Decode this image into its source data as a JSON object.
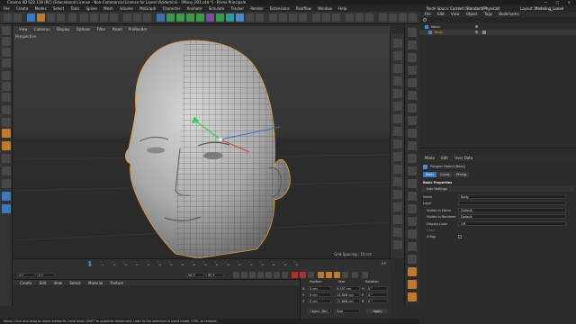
{
  "window": {
    "title": "Cinema 4D S22.118 (RC) (Educational License - Non-Commercial License for Lionel Vicidomini) - [Mono_003.c4d *] - Prima Principale",
    "controls": [
      "—",
      "□",
      "×"
    ]
  },
  "menubar": {
    "items": [
      "File",
      "Create",
      "Modes",
      "Select",
      "Tools",
      "Spline",
      "Mesh",
      "Volume",
      "MoGraph",
      "Character",
      "Animate",
      "Simulate",
      "Tracker",
      "Render",
      "Extensions",
      "Realflow",
      "Window",
      "Help"
    ],
    "node_space_label": "Node Space:",
    "node_space_value": "Current (Standard/Physical)",
    "layout_label": "Layout:",
    "layout_value": "Modeling_Lionel (User)"
  },
  "viewport": {
    "menu": [
      "View",
      "Cameras",
      "Display",
      "Options",
      "Filter",
      "Panel",
      "ProRender"
    ],
    "label": "Perspective",
    "grid_spacing": "Grid Spacing : 10 cm"
  },
  "timeline": {
    "ticks": [
      "0",
      "5",
      "10",
      "15",
      "20",
      "25",
      "30",
      "35",
      "40",
      "45",
      "50",
      "55",
      "60",
      "65",
      "70",
      "75",
      "80",
      "85",
      "90"
    ],
    "end_frame": "0 F",
    "start_field": "0 F",
    "current_field": "0 F",
    "max_field": "90 F",
    "end_field": "90 F"
  },
  "material_manager": {
    "menu": [
      "Create",
      "Edit",
      "View",
      "Select",
      "Material",
      "Texture"
    ]
  },
  "coordinates": {
    "headers": [
      "Position",
      "Size",
      "Rotation"
    ],
    "rows": [
      {
        "axis": "X",
        "pos": "0 cm",
        "size": "9.357 cm",
        "rot_axis": "H",
        "rot": "0 °"
      },
      {
        "axis": "Y",
        "pos": "0 cm",
        "size": "14.608 cm",
        "rot_axis": "P",
        "rot": "0 °"
      },
      {
        "axis": "Z",
        "pos": "0 cm",
        "size": "17.608 cm",
        "rot_axis": "B",
        "rot": "0 °"
      }
    ],
    "mode": "Object (Rel)",
    "size_mode": "Size",
    "apply_label": "Apply"
  },
  "status": {
    "text": "Move: Click and drag to move elements. Hold down SHIFT to quantize movement / add to the selection in point mode, CTRL to remove."
  },
  "object_manager": {
    "menu": [
      "File",
      "Edit",
      "View",
      "Object",
      "Tags",
      "Bookmarks"
    ],
    "objects": [
      {
        "name": "Mono",
        "type": "polygon",
        "selected": false
      },
      {
        "name": "Body",
        "type": "polygon",
        "selected": true
      }
    ]
  },
  "attribute_manager": {
    "menu": [
      "Mode",
      "Edit",
      "User Data"
    ],
    "title": "Polygon Object [Body]",
    "tabs": [
      "Basic",
      "Coord.",
      "Phong"
    ],
    "active_tab": "Basic",
    "section_title": "Basic Properties",
    "subsection": "Icon Settings",
    "fields": [
      {
        "label": "Name",
        "value": "Body"
      },
      {
        "label": "Layer",
        "value": ""
      },
      {
        "label": "Visible in Editor",
        "value": "Default"
      },
      {
        "label": "Visible in Renderer",
        "value": "Default"
      },
      {
        "label": "Display Color",
        "value": "Off"
      },
      {
        "label": "Color",
        "value": ""
      },
      {
        "label": "X-Ray",
        "value": ""
      }
    ]
  },
  "colors": {
    "accent_orange": "#f0a030",
    "selection_orange": "#ff9a1e",
    "active_blue": "#3a78c0",
    "panel_bg": "#2b2b2b"
  }
}
